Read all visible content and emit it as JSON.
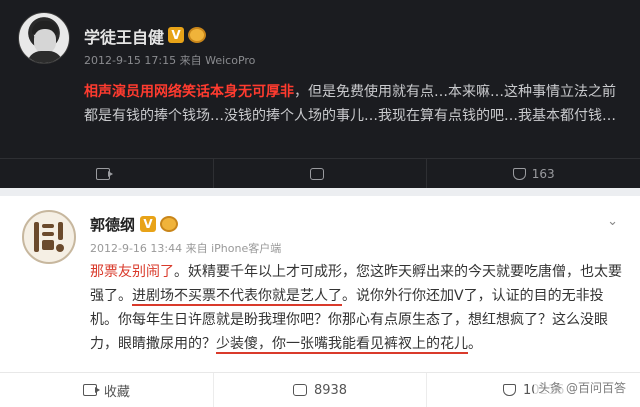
{
  "post1": {
    "username": "学徒王自健",
    "v_badge": "V",
    "meta": "2012-9-15 17:15 来自 WeicoPro",
    "highlight": "相声演员用网络笑话本身无可厚非",
    "body": "，但是免费使用就有点…本来嘛…这种事情立法之前都是有钱的捧个钱场…没钱的捧个人场的事儿…我现在算有点钱的吧…我基本都付钱…",
    "actions": {
      "repost": "",
      "comment": "",
      "like": "163"
    }
  },
  "post2": {
    "username": "郭德纲",
    "v_badge": "V",
    "meta": "2012-9-16 13:44 来自 iPhone客户端",
    "chevron": "⌄",
    "seg1_red": "那票友别闹了",
    "seg2": "。妖精要千年以上才可成形，您这昨天孵出来的今天就要吃唐僧，也太要强了。",
    "seg3_u": "进剧场不买票不代表你就是艺人了",
    "seg4": "。说你外行你还加V了，认证的目的无非投机。你每年生日许愿就是盼我理你吧？你那心有点原生态了，想红想疯了？这么没眼力，眼睛撒尿用的？",
    "seg5_u": "少装傻，你一张嘴我能看见裤衩上的花儿",
    "seg6": "。",
    "actions": {
      "repost": "收藏",
      "comment": "8938",
      "forward": "10216"
    }
  },
  "watermark": "头条 @百问百答"
}
